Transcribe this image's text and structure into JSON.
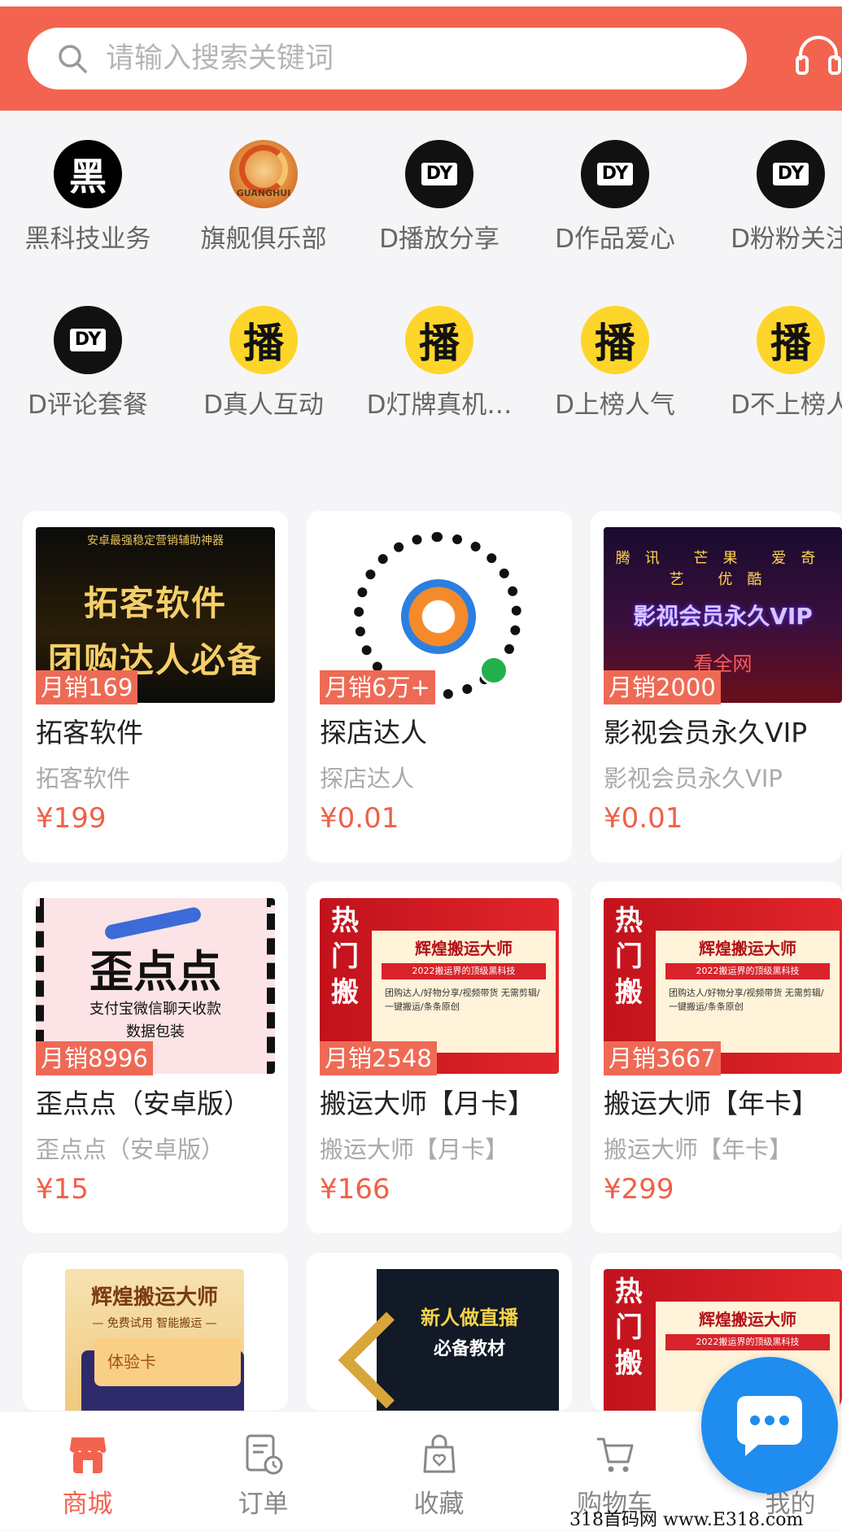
{
  "search": {
    "placeholder": "请输入搜索关键词"
  },
  "categories": [
    {
      "label": "黑科技业务",
      "icon": "hei-logo-icon",
      "glyph": "黑"
    },
    {
      "label": "旗舰俱乐部",
      "icon": "guanghui-dragon-logo-icon",
      "glyph": "GUANGHUI"
    },
    {
      "label": "D播放分享",
      "icon": "dy-logo-icon",
      "glyph": "DY"
    },
    {
      "label": "D作品爱心",
      "icon": "dy-logo-icon",
      "glyph": "DY"
    },
    {
      "label": "D粉粉关注",
      "icon": "dy-logo-icon",
      "glyph": "DY"
    },
    {
      "label": "D评论套餐",
      "icon": "dy-logo-icon",
      "glyph": "DY"
    },
    {
      "label": "D真人互动",
      "icon": "bo-logo-icon",
      "glyph": "播"
    },
    {
      "label": "D灯牌真机…",
      "icon": "bo-logo-icon",
      "glyph": "播"
    },
    {
      "label": "D上榜人气",
      "icon": "bo-logo-icon",
      "glyph": "播"
    },
    {
      "label": "D不上榜人",
      "icon": "bo-logo-icon",
      "glyph": "播"
    }
  ],
  "products": [
    {
      "sales": "月销169",
      "title": "拓客软件",
      "subtitle": "拓客软件",
      "price": "¥199",
      "image_text": {
        "top": "安卓最强稳定营销辅助神器",
        "l1": "拓客软件",
        "l2": "团购达人必备"
      }
    },
    {
      "sales": "月销6万+",
      "title": "探店达人",
      "subtitle": "探店达人",
      "price": "¥0.01"
    },
    {
      "sales": "月销2000",
      "title": "影视会员永久VIP",
      "subtitle": "影视会员永久VIP",
      "price": "¥0.01",
      "image_text": {
        "words": "腾讯 芒果 爱奇艺 优酷",
        "main": "影视会员永久VIP",
        "red": "看全网"
      }
    },
    {
      "sales": "月销8996",
      "title": "歪点点（安卓版）",
      "subtitle": "歪点点（安卓版）",
      "price": "¥15",
      "image_text": {
        "brand": "歪点点",
        "l1": "支付宝微信聊天收款",
        "l2": "数据包装"
      }
    },
    {
      "sales": "月销2548",
      "title": "搬运大师【月卡】",
      "subtitle": "搬运大师【月卡】",
      "price": "¥166",
      "image_text": {
        "vert": "热门搬",
        "title": "辉煌搬运大师",
        "band": "2022搬运界的顶级黑科技",
        "lines": "团购达人/好物分享/视频带货 无需剪辑/一键搬运/条条原创"
      }
    },
    {
      "sales": "月销3667",
      "title": "搬运大师【年卡】",
      "subtitle": "搬运大师【年卡】",
      "price": "¥299",
      "image_text": {
        "vert": "热门搬",
        "title": "辉煌搬运大师",
        "band": "2022搬运界的顶级黑科技",
        "lines": "团购达人/好物分享/视频带货 无需剪辑/一键搬运/条条原创"
      }
    },
    {
      "image_text": {
        "title": "辉煌搬运大师",
        "sub": "— 免费试用  智能搬运 —",
        "card": "体验卡"
      }
    },
    {
      "image_text": {
        "t1": "新人做直播",
        "t2": "必备教材"
      }
    },
    {
      "image_text": {
        "vert": "热门搬",
        "title": "辉煌搬运大师",
        "band": "2022搬运界的顶级黑科技"
      }
    }
  ],
  "nav": [
    {
      "label": "商城",
      "icon": "shop-icon",
      "active": true
    },
    {
      "label": "订单",
      "icon": "order-icon",
      "active": false
    },
    {
      "label": "收藏",
      "icon": "favorite-bag-icon",
      "active": false
    },
    {
      "label": "购物车",
      "icon": "cart-icon",
      "active": false
    },
    {
      "label": "我的",
      "icon": "profile-icon",
      "active": false
    }
  ],
  "watermark": "318首码网  www.E318.com",
  "colors": {
    "brand": "#f2644f",
    "price": "#f06048",
    "fab": "#1f8cf0"
  }
}
